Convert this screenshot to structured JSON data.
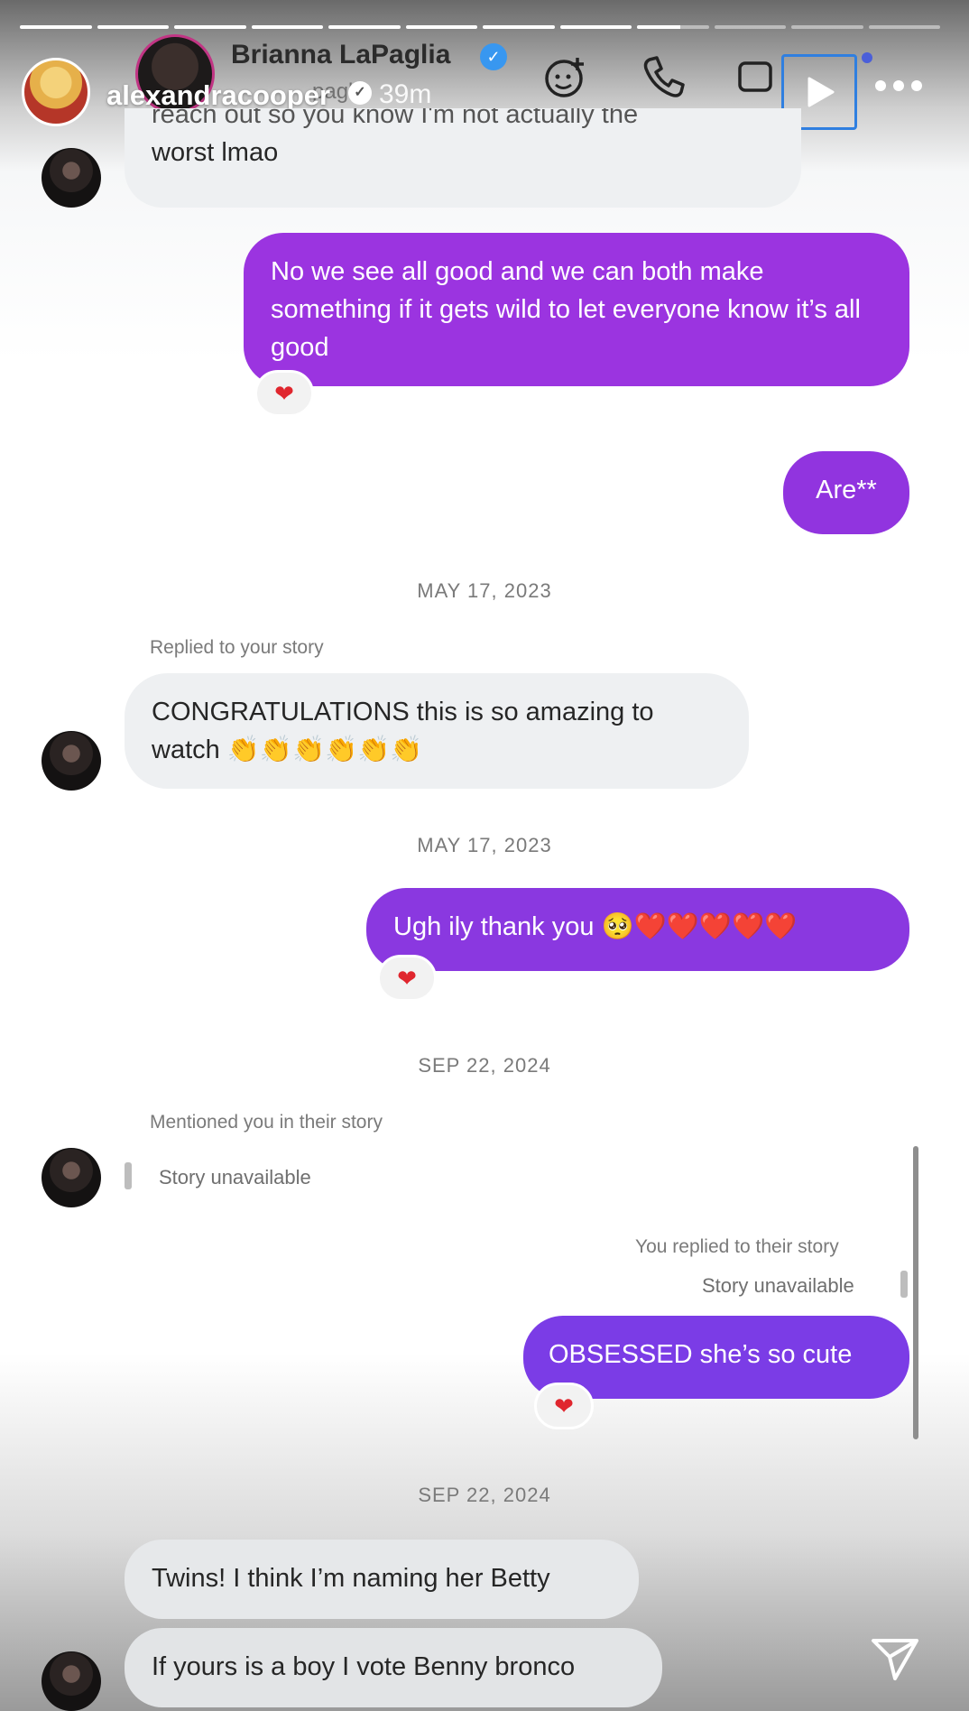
{
  "story": {
    "progress_segments": [
      1,
      1,
      1,
      1,
      1,
      1,
      1,
      1,
      0.6,
      0,
      0,
      0
    ],
    "owner": {
      "username": "alexandracooper",
      "time": "39m"
    }
  },
  "dm_header": {
    "name": "Brianna LaPaglia",
    "sub": "pagli"
  },
  "messages": {
    "m1": {
      "text_top": "reach out so you know I'm not actually the",
      "text": "worst lmao"
    },
    "m2": {
      "text": "No we see all good and we can both make something if it gets wild to let everyone know it’s all good",
      "reaction": "❤"
    },
    "m3": {
      "text": "Are**"
    },
    "date1": "MAY 17, 2023",
    "m4": {
      "meta": "Replied to your story",
      "text": "CONGRATULATIONS this is so amazing to watch 👏👏👏👏👏👏"
    },
    "date2": "MAY 17, 2023",
    "m5": {
      "text": "Ugh ily thank you 🥺❤️❤️❤️❤️❤️",
      "reaction": "❤"
    },
    "date3": "SEP 22, 2024",
    "m6": {
      "meta": "Mentioned you in their story",
      "text": "Story unavailable"
    },
    "m7": {
      "meta": "You replied to their story",
      "story": "Story unavailable",
      "text": "OBSESSED she’s so cute",
      "reaction": "❤"
    },
    "date4": "SEP 22, 2024",
    "m8": {
      "text": "Twins! I think I’m naming her Betty"
    },
    "m9": {
      "text": "If yours is a boy I vote Benny bronco"
    }
  },
  "colors": {
    "outgoing_purple": "#9b34e0",
    "outgoing_violet": "#7b3ce6",
    "incoming_gray": "#eef0f2",
    "reaction_red": "#e0262e"
  }
}
